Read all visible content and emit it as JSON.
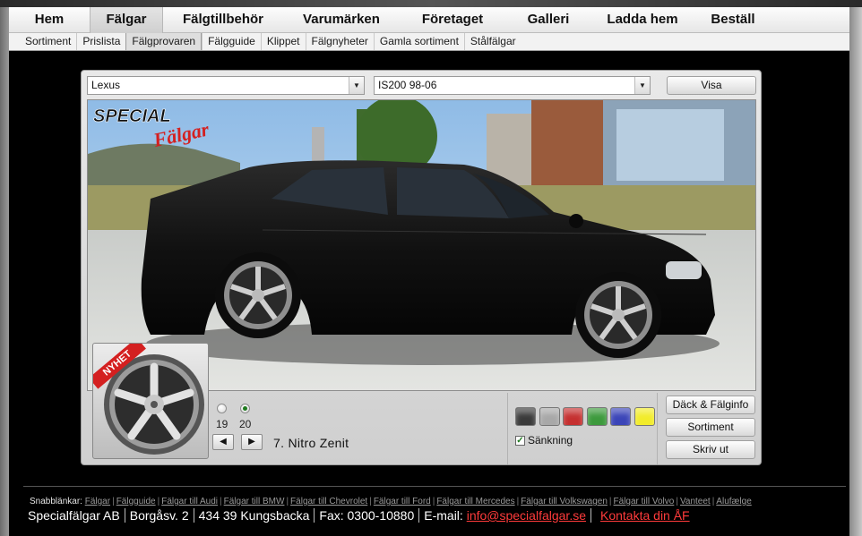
{
  "main_nav": [
    "Hem",
    "Fälgar",
    "Fälgtillbehör",
    "Varumärken",
    "Företaget",
    "Galleri",
    "Ladda hem",
    "Beställ"
  ],
  "main_nav_active": "Fälgar",
  "sub_nav": [
    "Sortiment",
    "Prislista",
    "Fälgprovaren",
    "Fälgguide",
    "Klippet",
    "Fälgnyheter",
    "Gamla sortiment",
    "Stålfälgar"
  ],
  "sub_nav_active": "Fälgprovaren",
  "viewer": {
    "make_select": "Lexus",
    "model_select": "IS200 98-06",
    "visa_label": "Visa",
    "logo_text_top": "SPECIAL",
    "logo_text_script": "Fälgar",
    "new_badge": "NYHET",
    "sizes": [
      {
        "label": "19",
        "selected": false
      },
      {
        "label": "20",
        "selected": true
      }
    ],
    "prev_icon": "◀",
    "next_icon": "▶",
    "wheel_name": "7. Nitro Zenit",
    "color_swatches": [
      "#3a3a3a",
      "#a8a8a8",
      "#c53030",
      "#3d9a3d",
      "#3b45b8",
      "#f2ec2a"
    ],
    "lowering_label": "Sänkning",
    "lowering_checked": true,
    "buttons": [
      "Däck & Fälginfo",
      "Sortiment",
      "Skriv ut"
    ]
  },
  "footer": {
    "quicklinks_label": "Snabblänkar:",
    "quicklinks": [
      "Fälgar",
      "Fälgguide",
      "Fälgar till Audi",
      "Fälgar till BMW",
      "Fälgar till Chevrolet",
      "Fälgar till Ford",
      "Fälgar till Mercedes",
      "Fälgar till Volkswagen",
      "Fälgar till Volvo",
      "Vanteet",
      "Alufælge"
    ],
    "company": "Specialfälgar AB",
    "address": "Borgåsv. 2",
    "postal": "434 39 Kungsbacka",
    "fax": "Fax: 0300-10880",
    "email_label": "E-mail:",
    "email": "info@specialfalgar.se",
    "contact_link": "Kontakta din ÅF"
  }
}
